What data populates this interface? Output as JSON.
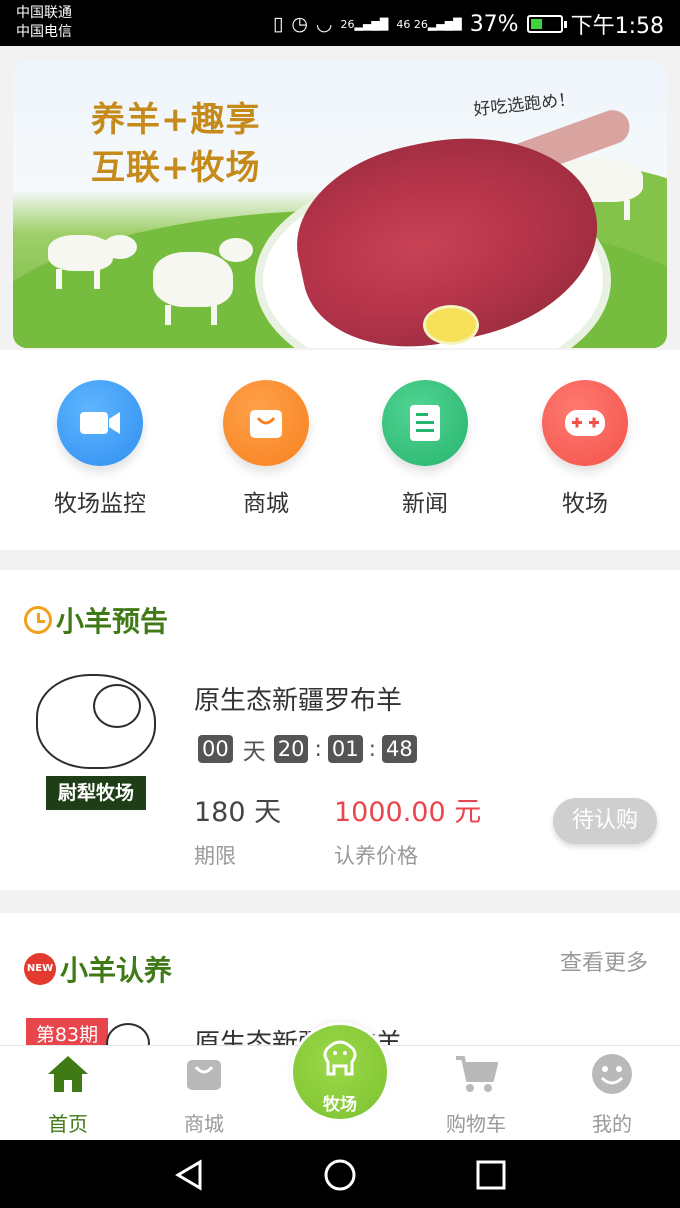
{
  "status_bar": {
    "carrier_1": "中国联通",
    "carrier_2": "中国电信",
    "network_1": "26",
    "network_2": "46 26",
    "battery": "37%",
    "time": "下午1:58"
  },
  "banner": {
    "line1": "养羊+趣享",
    "line2": "互联+牧场",
    "slogan": "好吃选跑め！"
  },
  "menu": [
    {
      "label": "牧场监控",
      "icon": "video-camera-icon",
      "color": "#3a9cf6"
    },
    {
      "label": "商城",
      "icon": "shopping-bag-icon",
      "color": "#f98c2c"
    },
    {
      "label": "新闻",
      "icon": "news-document-icon",
      "color": "#33c07b"
    },
    {
      "label": "牧场",
      "icon": "gamepad-icon",
      "color": "#f55f57"
    }
  ],
  "presale": {
    "section_title": "小羊预告",
    "product_name": "原生态新疆罗布羊",
    "logo_text": "尉犁牧场",
    "countdown": {
      "days": "00",
      "day_unit": "天",
      "hours": "20",
      "minutes": "01",
      "seconds": "48",
      "separator": ":"
    },
    "term_value": "180 天",
    "term_label": "期限",
    "price_value": "1000.00 元",
    "price_label": "认养价格",
    "button": "待认购"
  },
  "adopt": {
    "section_title": "小羊认养",
    "badge": "NEW",
    "more": "查看更多",
    "period_tag": "第83期",
    "product_name": "原生态新疆罗布羊"
  },
  "tabbar": {
    "home": "首页",
    "mall": "商城",
    "ranch": "牧场",
    "cart": "购物车",
    "mine": "我的",
    "active_color": "#3f7a17"
  }
}
